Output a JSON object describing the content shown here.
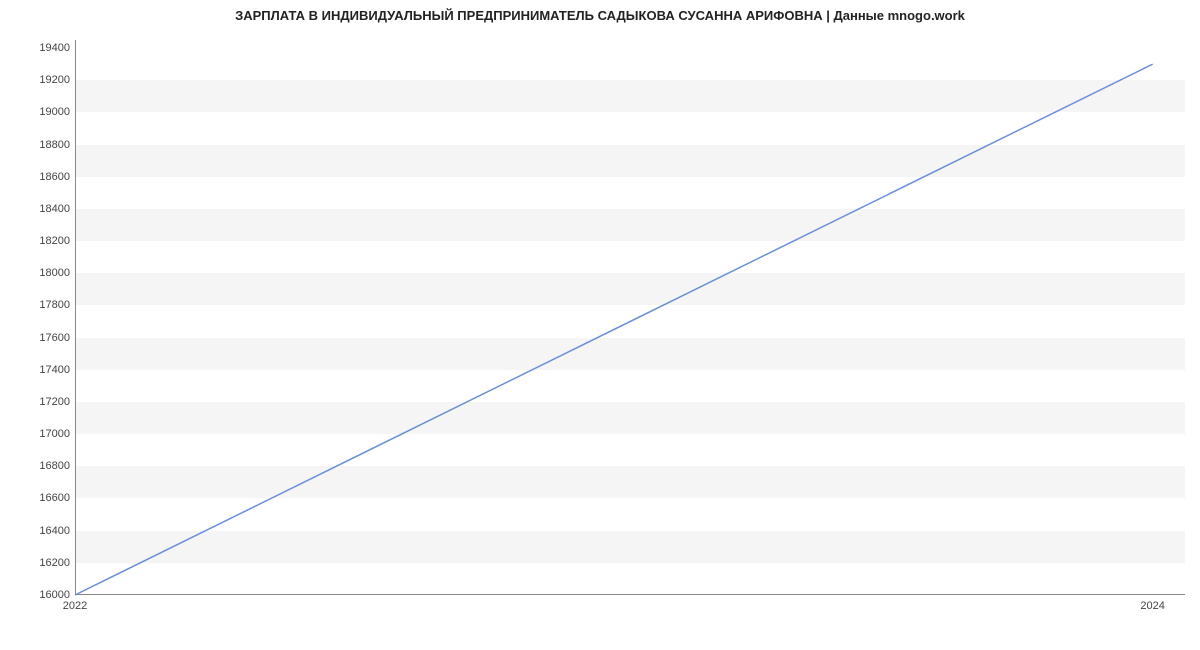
{
  "chart_data": {
    "type": "line",
    "title": "ЗАРПЛАТА В ИНДИВИДУАЛЬНЫЙ ПРЕДПРИНИМАТЕЛЬ САДЫКОВА СУСАННА АРИФОВНА | Данные mnogo.work",
    "xlabel": "",
    "ylabel": "",
    "x": [
      2022,
      2024
    ],
    "values": [
      16000,
      19300
    ],
    "xlim": [
      2022,
      2024.06
    ],
    "ylim": [
      16000,
      19450
    ],
    "y_ticks": [
      16000,
      16200,
      16400,
      16600,
      16800,
      17000,
      17200,
      17400,
      17600,
      17800,
      18000,
      18200,
      18400,
      18600,
      18800,
      19000,
      19200,
      19400
    ],
    "x_ticks": [
      2022,
      2024
    ],
    "line_color": "#6a8fd8",
    "band_color": "#f5f5f5",
    "grid": false
  }
}
